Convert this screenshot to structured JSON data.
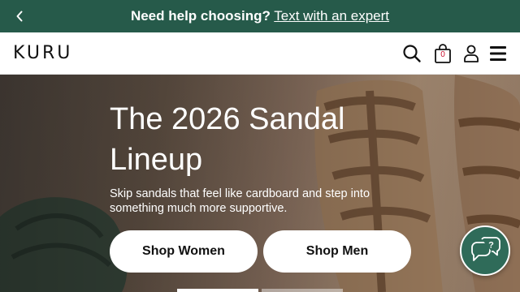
{
  "announcement": {
    "bold_text": "Need help choosing?",
    "link_text": "Text with an expert",
    "prev_icon": "chevron-left-icon"
  },
  "header": {
    "logo_text": "KURU",
    "cart_count": "0",
    "icons": [
      "search-icon",
      "shopping-bag-icon",
      "account-icon",
      "menu-icon"
    ]
  },
  "hero": {
    "title": "The 2026 Sandal Lineup",
    "subtitle": "Skip sandals that feel like cardboard and step into something much more supportive.",
    "buttons": {
      "women": "Shop Women",
      "men": "Shop Men"
    },
    "slide_indicator": {
      "active": 1,
      "total": 2
    }
  },
  "chat": {
    "icon": "chat-help-icon",
    "glyph": "?"
  },
  "colors": {
    "brand_green": "#265a4a",
    "cart_count": "#c8102e"
  }
}
